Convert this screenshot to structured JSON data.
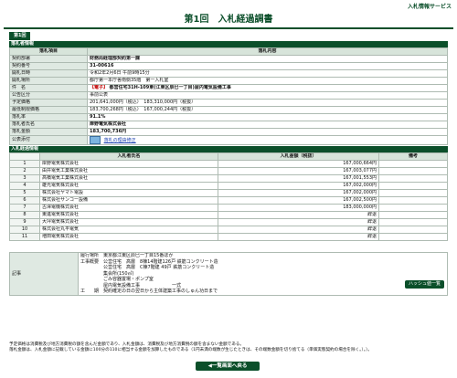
{
  "header": {
    "service": "入札情報サービス",
    "title": "第1回　入札経過調書"
  },
  "tab_label": "第1回",
  "info_section": {
    "heading": "落札者情報",
    "col_item": "落札項目",
    "col_content": "落札内容",
    "rows": [
      {
        "label": "契約部署",
        "value": "財務局経理部契約第一課"
      },
      {
        "label": "契約番号",
        "value": "31-00616"
      },
      {
        "label": "開札日時",
        "value": "令和2年2月6日 午前9時15分"
      },
      {
        "label": "開札場所",
        "value": "都庁第一本庁舎南側35階　第一入札室"
      },
      {
        "label": "件　名",
        "prefix": "【電子】",
        "value": "都営住宅31H-109東(江東区辰巳一丁目)屋内電気設備工事"
      },
      {
        "label": "公告区分",
        "value": "事前公表"
      },
      {
        "label": "予定価格",
        "value": "201,641,000円（税込）　183,310,000円（税抜）"
      },
      {
        "label": "最低制限価格",
        "value": "183,700,268円（税込）　167,000,244円（税抜）"
      },
      {
        "label": "落札率",
        "value": "91.1%"
      },
      {
        "label": "落札者氏名",
        "value": "岸野電気株式会社"
      },
      {
        "label": "落札金額",
        "value": "183,700,736円"
      },
      {
        "label": "公表添付",
        "link": "落札の理由修正"
      }
    ]
  },
  "bid_section": {
    "heading": "入札経過情報",
    "col_bidder": "入札者氏名",
    "col_amount": "入札金額（税抜）",
    "col_remark": "備考",
    "rows": [
      {
        "no": "1",
        "name": "岸野電気株式会社",
        "amount": "167,000,664円",
        "remark": ""
      },
      {
        "no": "2",
        "name": "由井電気工業株式会社",
        "amount": "167,003,077円",
        "remark": ""
      },
      {
        "no": "3",
        "name": "高橋電気工業株式会社",
        "amount": "167,001,553円",
        "remark": ""
      },
      {
        "no": "4",
        "name": "雄光電気株式会社",
        "amount": "167,002,000円",
        "remark": ""
      },
      {
        "no": "5",
        "name": "株式会社ヤマト電設",
        "amount": "167,002,000円",
        "remark": ""
      },
      {
        "no": "6",
        "name": "株式会社サンコー設備",
        "amount": "167,002,500円",
        "remark": ""
      },
      {
        "no": "7",
        "name": "古澤電機株式会社",
        "amount": "183,000,000円",
        "remark": ""
      },
      {
        "no": "8",
        "name": "東進電気株式会社",
        "amount": "辞退",
        "remark": ""
      },
      {
        "no": "9",
        "name": "大坪電気株式会社",
        "amount": "辞退",
        "remark": ""
      },
      {
        "no": "10",
        "name": "株式会社丸平電気",
        "amount": "辞退",
        "remark": ""
      },
      {
        "no": "11",
        "name": "増田電気株式会社",
        "amount": "辞退",
        "remark": ""
      }
    ]
  },
  "history_button": "ハッシュ値一覧",
  "memo": {
    "label": "記事",
    "lines": [
      "履行場所　東京都江東区辰巳一丁目15番ほか",
      "工事概要　公営住宅　高層　8棟14階建126戸 鉄筋コンクリート造",
      "　　　　　公営住宅　高層　C棟7階建 49戸 鉄筋コンクリート造",
      "　　　　　集会所(150㎡)",
      "　　　　　ごみ容器置場・ポンプ室",
      "　　　　　屋内電気設備工事　　　　　　　一式",
      "工　　期　契約確定の日の翌日から主体建築工事のしゅん功日まで"
    ]
  },
  "notes": [
    "予定価格は消費税及び地方消費税の額を含んだ金額であり、入札金額は、消費税及び地方消費税の額を含まない金額である。",
    "落札金額は、入札金額に記載している金額に100分の110に相当する金額を加算したものである（1円未満の端数が生じたときは、その端数金額を切り捨てる（単価実態契約の場合を除く。）。）。"
  ],
  "back_button": "◀一覧画面へ戻る"
}
